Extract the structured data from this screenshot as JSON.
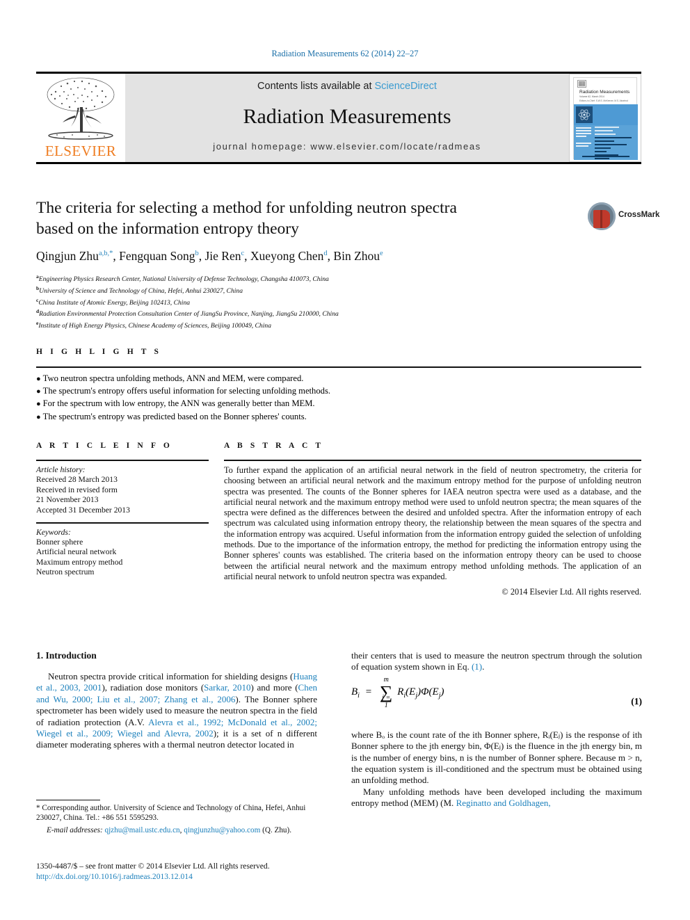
{
  "running_head": "Radiation Measurements 62 (2014) 22–27",
  "masthead": {
    "publisher_name": "ELSEVIER",
    "contents_prefix": "Contents lists available at ",
    "contents_link": "ScienceDirect",
    "journal_name": "Radiation Measurements",
    "homepage": "journal homepage: www.elsevier.com/locate/radmeas",
    "cover": {
      "title": "Radiation Measurements",
      "sub": "Volume 62, March 2014",
      "sub2": "Editors-in-Chief: S.W.S. McKeever, M.S. Akselrod"
    }
  },
  "article": {
    "title_line1": "The criteria for selecting a method for unfolding neutron spectra",
    "title_line2": "based on the information entropy theory",
    "crossmark_label": "CrossMark",
    "authors": [
      {
        "name": "Qingjun Zhu",
        "marks": "a,b,*"
      },
      {
        "name": "Fengquan Song",
        "marks": "b"
      },
      {
        "name": "Jie Ren",
        "marks": "c"
      },
      {
        "name": "Xueyong Chen",
        "marks": "d"
      },
      {
        "name": "Bin Zhou",
        "marks": "e"
      }
    ],
    "affiliations": [
      {
        "mark": "a",
        "text": "Engineering Physics Research Center, National University of Defense Technology, Changsha 410073, China"
      },
      {
        "mark": "b",
        "text": "University of Science and Technology of China, Hefei, Anhui 230027, China"
      },
      {
        "mark": "c",
        "text": "China Institute of Atomic Energy, Beijing 102413, China"
      },
      {
        "mark": "d",
        "text": "Radiation Environmental Protection Consultation Center of JiangSu Province, Nanjing, JiangSu 210000, China"
      },
      {
        "mark": "e",
        "text": "Institute of High Energy Physics, Chinese Academy of Sciences, Beijing 100049, China"
      }
    ]
  },
  "highlights": {
    "heading": "H I G H L I G H T S",
    "items": [
      "Two neutron spectra unfolding methods, ANN and MEM, were compared.",
      "The spectrum's entropy offers useful information for selecting unfolding methods.",
      "For the spectrum with low entropy, the ANN was generally better than MEM.",
      "The spectrum's entropy was predicted based on the Bonner spheres' counts."
    ]
  },
  "article_info": {
    "heading": "A R T I C L E   I N F O",
    "history_label": "Article history:",
    "history": [
      "Received 28 March 2013",
      "Received in revised form",
      "21 November 2013",
      "Accepted 31 December 2013"
    ],
    "keywords_label": "Keywords:",
    "keywords": [
      "Bonner sphere",
      "Artificial neural network",
      "Maximum entropy method",
      "Neutron spectrum"
    ]
  },
  "abstract": {
    "heading": "A B S T R A C T",
    "text": "To further expand the application of an artificial neural network in the field of neutron spectrometry, the criteria for choosing between an artificial neural network and the maximum entropy method for the purpose of unfolding neutron spectra was presented. The counts of the Bonner spheres for IAEA neutron spectra were used as a database, and the artificial neural network and the maximum entropy method were used to unfold neutron spectra; the mean squares of the spectra were defined as the differences between the desired and unfolded spectra. After the information entropy of each spectrum was calculated using information entropy theory, the relationship between the mean squares of the spectra and the information entropy was acquired. Useful information from the information entropy guided the selection of unfolding methods. Due to the importance of the information entropy, the method for predicting the information entropy using the Bonner spheres' counts was established. The criteria based on the information entropy theory can be used to choose between the artificial neural network and the maximum entropy method unfolding methods. The application of an artificial neural network to unfold neutron spectra was expanded.",
    "copyright": "© 2014 Elsevier Ltd. All rights reserved."
  },
  "body": {
    "section_number_title": "1. Introduction",
    "left_para_1_a": "Neutron spectra provide critical information for shielding designs (",
    "left_cite_1": "Huang et al., 2003, 2001",
    "left_para_1_b": "), radiation dose monitors (",
    "left_cite_2": "Sarkar, 2010",
    "left_para_1_c": ") and more (",
    "left_cite_3": "Chen and Wu, 2000; Liu et al., 2007; Zhang et al., 2006",
    "left_para_1_d": "). The Bonner sphere spectrometer has been widely used to measure the neutron spectra in the field of radiation protection (A.V. ",
    "left_cite_4": "Alevra et al., 1992; McDonald et al., 2002; Wiegel et al., 2009; Wiegel and Alevra, 2002",
    "left_para_1_e": "); it is a set of n different diameter moderating spheres with a thermal neutron detector located in",
    "right_para_1_a": "their centers that is used to measure the neutron spectrum through the solution of equation system shown in Eq. ",
    "right_cite_eq": "(1)",
    "right_para_1_b": ".",
    "equation": {
      "lhs": "B",
      "lhs_sub": "i",
      "eq": "=",
      "sum_top": "m",
      "sum_bottom": "j = 1",
      "rhs": "R",
      "rhs_sub": "i",
      "rhs_arg": "(E",
      "rhs_arg_sub": "j",
      "rhs_arg_close": ")",
      "phi": "Φ(E",
      "phi_sub": "j",
      "phi_close": ")",
      "number": "(1)"
    },
    "right_para_2": "where Bₒ is the count rate of the ith Bonner sphere, Rᵢ(Eⱼ) is the response of ith Bonner sphere to the jth energy bin, Φ(Eⱼ) is the fluence in the jth energy bin, m is the number of energy bins, n is the number of Bonner sphere. Because m > n, the equation system is ill-conditioned and the spectrum must be obtained using an unfolding method.",
    "right_para_3_a": "Many unfolding methods have been developed including the maximum entropy method (MEM) (M. ",
    "right_cite_5": "Reginatto and Goldhagen,"
  },
  "footnote": {
    "corresponding": "* Corresponding author. University of Science and Technology of China, Hefei, Anhui 230027, China. Tel.: +86 551 5595293.",
    "email_label": "E-mail addresses:",
    "email_1": "qjzhu@mail.ustc.edu.cn",
    "email_sep": ", ",
    "email_2": "qingjunzhu@yahoo.com",
    "email_suffix": " (Q. Zhu)."
  },
  "footer": {
    "issn_line": "1350-4487/$ – see front matter © 2014 Elsevier Ltd. All rights reserved.",
    "doi": "http://dx.doi.org/10.1016/j.radmeas.2013.12.014"
  },
  "colors": {
    "link": "#1a7fbb",
    "sciencedirect": "#3a9bd0",
    "elsevier_orange": "#ef7d22",
    "runhead": "#1a6fa8"
  }
}
